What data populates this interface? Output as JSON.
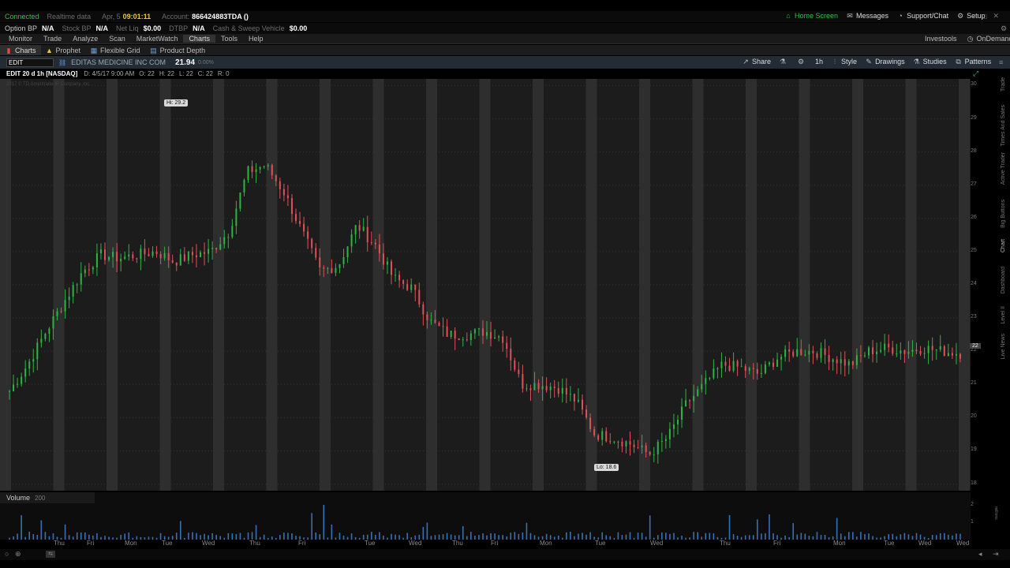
{
  "status": {
    "connected": "Connected",
    "realtime": "Realtime data",
    "date": "Apr, 5",
    "time": "09:01:11",
    "account_label": "Account:",
    "account_value": "866424883TDA ()"
  },
  "header_right": {
    "home_screen": "Home Screen",
    "messages": "Messages",
    "support": "Support/Chat",
    "setup": "Setup"
  },
  "account": {
    "option_bp_label": "Option BP",
    "option_bp_value": "N/A",
    "stock_bp_label": "Stock BP",
    "stock_bp_value": "N/A",
    "net_liq_label": "Net Liq",
    "net_liq_value": "$0.00",
    "dtbp_label": "DTBP",
    "dtbp_value": "N/A",
    "cash_label": "Cash & Sweep Vehicle",
    "cash_value": "$0.00"
  },
  "menu": [
    "Monitor",
    "Trade",
    "Analyze",
    "Scan",
    "MarketWatch",
    "Charts",
    "Tools",
    "Help"
  ],
  "menu_active": "Charts",
  "menu_right": {
    "investools": "Investools",
    "ondemand": "OnDemand"
  },
  "subtabs": [
    "Charts",
    "Prophet",
    "Flexible Grid",
    "Product Depth"
  ],
  "symbol": {
    "input_value": "EDIT",
    "company": "EDITAS MEDICINE INC COM",
    "price": "21.94",
    "change": "0.00%"
  },
  "toolbar": {
    "share": "Share",
    "timeframe": "1h",
    "style": "Style",
    "drawings": "Drawings",
    "studies": "Studies",
    "patterns": "Patterns"
  },
  "info": {
    "title": "EDIT 20 d 1h [NASDAQ]",
    "ohlc": "D: 4/5/17 9:00 AM",
    "o": "O: 22",
    "h": "H: 22",
    "l": "L: 22",
    "c": "C: 22",
    "r": "R: 0",
    "copyright": "2017 © TD Ameritrade IP Company, Inc."
  },
  "markers": {
    "hi": "Hi: 29.2",
    "lo": "Lo: 18.6",
    "last": "22"
  },
  "volume": {
    "label": "Volume",
    "value": "200",
    "units": "millions",
    "ticks": [
      "2",
      "1"
    ]
  },
  "side_tabs": [
    "Trade",
    "Times And Sales",
    "Active Trader",
    "Big Buttons",
    "Chart",
    "Dashboard",
    "Level II",
    "Live News"
  ],
  "chart_data": {
    "type": "candlestick",
    "symbol": "EDIT",
    "ylim": [
      17.8,
      30.2
    ],
    "yticks": [
      18,
      19,
      20,
      21,
      22,
      23,
      24,
      25,
      26,
      27,
      28,
      29,
      30
    ],
    "xticks": [
      "Thu",
      "Fri",
      "Mon",
      "Tue",
      "Wed",
      "Thu",
      "Fri",
      "Mon",
      "Tue",
      "Wed",
      "Thu",
      "Fri",
      "Mon",
      "Tue",
      "Wed",
      "Thu",
      "Fri",
      "Mon",
      "Tue",
      "Wed"
    ],
    "close_path": [
      20.8,
      21.6,
      22.6,
      23.5,
      24.4,
      24.9,
      24.8,
      24.9,
      25.0,
      24.7,
      24.9,
      25.0,
      25.6,
      27.4,
      27.6,
      26.8,
      25.6,
      24.4,
      24.6,
      25.8,
      25.2,
      24.2,
      23.9,
      22.9,
      22.5,
      22.5,
      22.6,
      22.4,
      21.0,
      21.0,
      20.9,
      20.5,
      19.5,
      19.4,
      19.2,
      18.9,
      19.4,
      20.4,
      21.0,
      21.6,
      21.5,
      21.3,
      21.8,
      22.0,
      22.0,
      21.8,
      21.6,
      22.0,
      22.1,
      22.0,
      22.1,
      22.0,
      21.94
    ],
    "hi": 29.2,
    "lo": 18.6
  }
}
